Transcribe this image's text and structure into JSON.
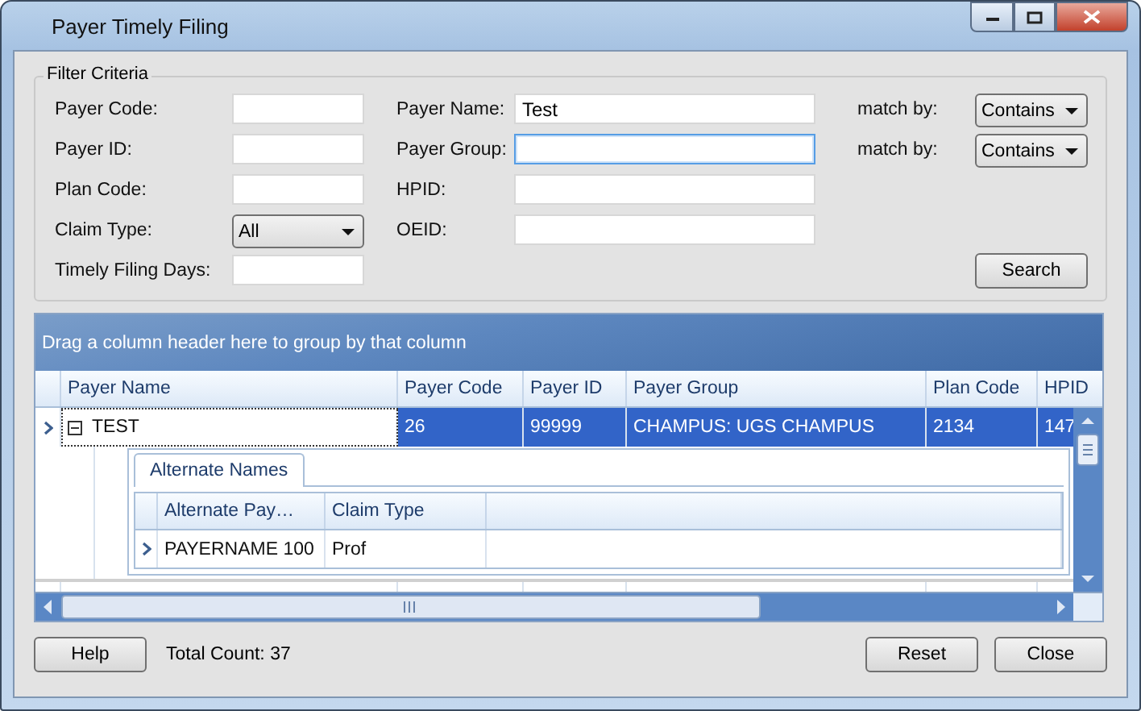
{
  "window": {
    "title": "Payer Timely Filing"
  },
  "filter": {
    "legend": "Filter Criteria",
    "left": [
      {
        "label": "Payer Code:",
        "kind": "text",
        "focused": false
      },
      {
        "label": "Payer ID:",
        "kind": "text",
        "focused": false
      },
      {
        "label": "Plan Code:",
        "kind": "text",
        "focused": false
      },
      {
        "label": "Claim Type:",
        "kind": "select",
        "value": "All"
      },
      {
        "label": "Timely Filing Days:",
        "kind": "text",
        "focused": false
      }
    ],
    "middle": [
      {
        "label": "Payer Name:",
        "kind": "text",
        "value": "Test",
        "focused": false
      },
      {
        "label": "Payer Group:",
        "kind": "text",
        "focused": true
      },
      {
        "label": "HPID:",
        "kind": "text",
        "focused": false
      },
      {
        "label": "OEID:",
        "kind": "text",
        "focused": false
      }
    ],
    "match": [
      {
        "label": "match by:",
        "value": "Contains"
      },
      {
        "label": "match by:",
        "value": "Contains"
      }
    ],
    "search_button": "Search"
  },
  "grid": {
    "group_hint": "Drag a column header here to group by that column",
    "columns": [
      "Payer Name",
      "Payer Code",
      "Payer ID",
      "Payer Group",
      "Plan Code",
      "HPID"
    ],
    "rows": [
      {
        "selected": true,
        "expanded": true,
        "cells": [
          "TEST",
          "26",
          "99999",
          "CHAMPUS: UGS CHAMPUS",
          "2134",
          "147"
        ],
        "detail": {
          "tabs": [
            {
              "label": "Alternate Names",
              "selected": true
            }
          ],
          "columns": [
            "Alternate Pay…",
            "Claim Type"
          ],
          "rows": [
            {
              "cells": [
                "PAYERNAME 100",
                "Prof"
              ]
            }
          ]
        }
      }
    ]
  },
  "footer": {
    "help_button": "Help",
    "total_count": "Total Count: 37",
    "reset_button": "Reset",
    "close_button": "Close"
  }
}
